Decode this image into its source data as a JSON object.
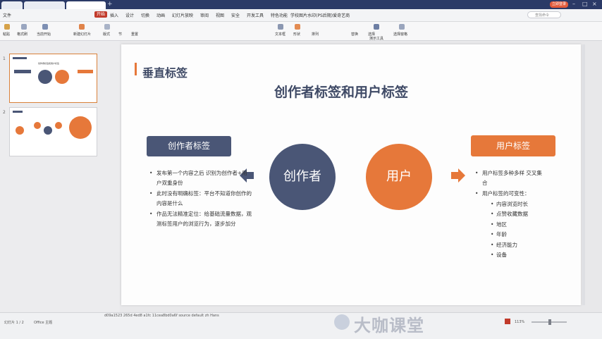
{
  "titlebar": {
    "tabs": [
      "",
      "",
      "",
      ""
    ],
    "signin_label": "立即登录"
  },
  "menu": {
    "items": [
      "文件",
      "开始",
      "插入",
      "设计",
      "切换",
      "动画",
      "幻灯片放映",
      "审阅",
      "视图",
      "安全",
      "开发工具",
      "特色功能",
      "学校图片水印(PS后期)爱奇艺商"
    ],
    "active_index": 1,
    "search_placeholder": "查找命令"
  },
  "ribbon": {
    "buttons": [
      "粘贴",
      "格式刷",
      "当前开始",
      "新建幻灯片",
      "版式",
      "节",
      "重置",
      "文本框",
      "形状",
      "排列",
      "替换",
      "选择",
      "演示工具",
      "选择窗格"
    ]
  },
  "leftpane": {
    "thumbnails": [
      {
        "number": "1",
        "title": "创作者标签和用户标签",
        "selected": true
      },
      {
        "number": "2",
        "title": "",
        "selected": false
      }
    ]
  },
  "slide": {
    "section_title": "垂直标签",
    "main_title": "创作者标签和用户标签",
    "left_label": "创作者标签",
    "right_label": "用户标签",
    "circle_left": "创作者",
    "circle_right": "用户",
    "left_bullets": [
      "发布第一个内容之后 识别为创作者+用户双重身份",
      "此时没有明确标签：平台不知道你创作的内容是什么",
      "作品无法精准定位：给基础流量数据，观测标签用户的浏览行为，逐步加分"
    ],
    "right_bullets": [
      "用户标签多种多样 交叉集合",
      "用户标签的可变性："
    ],
    "right_sub_bullets": [
      "内容浏览时长",
      "点赞收藏数据",
      "地区",
      "年龄",
      "经济能力",
      "设备"
    ],
    "colors": {
      "navy": "#4a5676",
      "orange": "#e6783a",
      "title_orange": "#e6783a"
    }
  },
  "status": {
    "notes_line": "d09a1523 265d 4ed8 a1fc 11cea8bd0a6f source default zh Hans",
    "slide_info": "幻灯片 1 / 2",
    "theme": "Office 主题",
    "zoom": "113%",
    "watermark": "大咖课堂"
  }
}
